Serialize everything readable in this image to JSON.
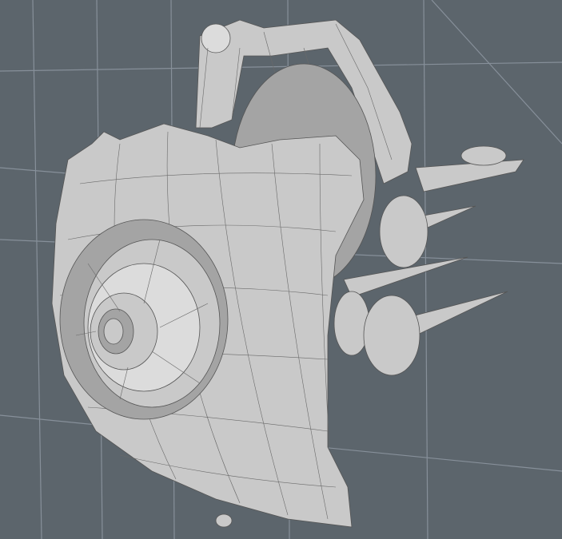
{
  "viewport": {
    "background_color": "#5c656c",
    "grid_color": "#87909a",
    "mesh_color": "#c9c9c9",
    "wireframe_color": "#555555"
  }
}
